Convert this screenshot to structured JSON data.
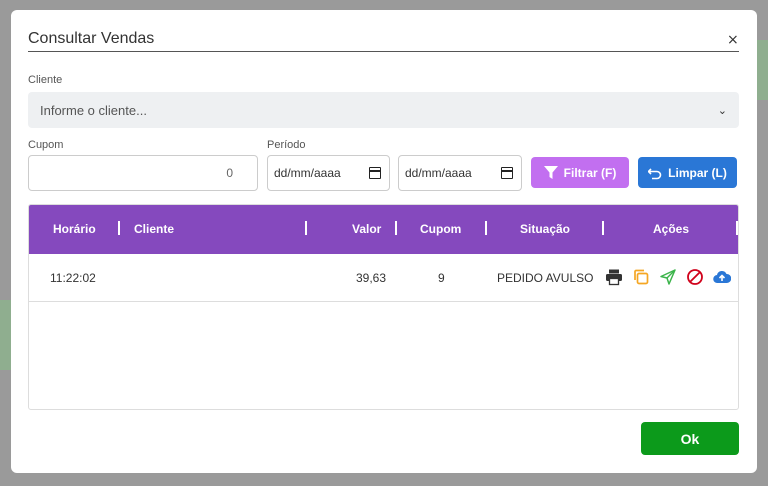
{
  "dialog": {
    "title": "Consultar Vendas",
    "close_label": "×"
  },
  "cliente": {
    "label": "Cliente",
    "placeholder": "Informe o cliente..."
  },
  "cupom": {
    "label": "Cupom",
    "value": "0"
  },
  "periodo": {
    "label": "Período",
    "start_value": "dd/mm/aaaa",
    "end_value": "dd/mm/aaaa"
  },
  "buttons": {
    "filter_label": "Filtrar (F)",
    "clear_label": "Limpar (L)",
    "ok_label": "Ok"
  },
  "table": {
    "headers": [
      "Horário",
      "Cliente",
      "Valor",
      "Cupom",
      "Situação",
      "Ações"
    ],
    "rows": [
      {
        "horario": "11:22:02",
        "cliente": "",
        "valor": "39,63",
        "cupom": "9",
        "situacao": "PEDIDO AVULSO"
      }
    ]
  },
  "colors": {
    "header_bg": "#8549be",
    "filter_btn": "#c26ff0",
    "clear_btn": "#2a77d6",
    "ok_btn": "#0c9a1b",
    "print_icon": "#333333",
    "copy_icon": "#f5a623",
    "send_icon": "#3cb44b",
    "cancel_icon": "#d0021b",
    "upload_icon": "#2a77d6"
  },
  "icons": {
    "filter": "funnel-icon",
    "clear": "undo-icon",
    "actions": [
      "printer-icon",
      "copy-icon",
      "send-icon",
      "cancel-icon",
      "cloud-upload-icon"
    ]
  }
}
